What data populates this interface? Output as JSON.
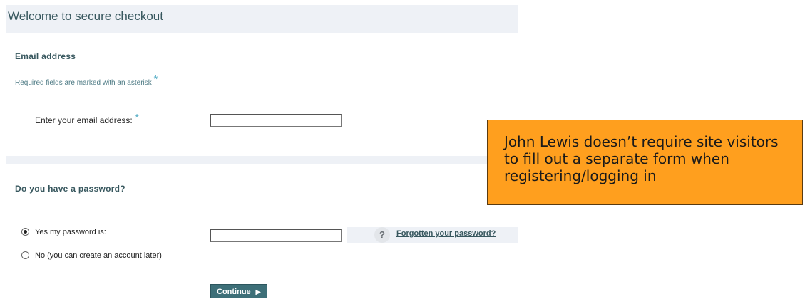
{
  "header": {
    "title": "Welcome to secure checkout"
  },
  "email_section": {
    "title": "Email address",
    "required_note": "Required fields are marked with an asterisk",
    "asterisk": "*",
    "email_label": "Enter your email address:",
    "email_value": ""
  },
  "password_section": {
    "title": "Do you have a password?",
    "yes_label": "Yes my password is:",
    "no_label": "No (you can create an account later)",
    "password_value": "",
    "help_icon": "?",
    "forgot_link": "Forgotten your password?",
    "selected_option": "yes"
  },
  "continue_button": {
    "label": "Continue",
    "arrow": "▶"
  },
  "callout": {
    "text": "John Lewis doesn’t require site visitors to fill out a separate form when registering/logging in",
    "background": "#ff9f1e"
  },
  "colors": {
    "heading": "#37575e",
    "accent": "#5fb2c9",
    "panel": "#eef1f6",
    "button": "#3d6f78"
  }
}
